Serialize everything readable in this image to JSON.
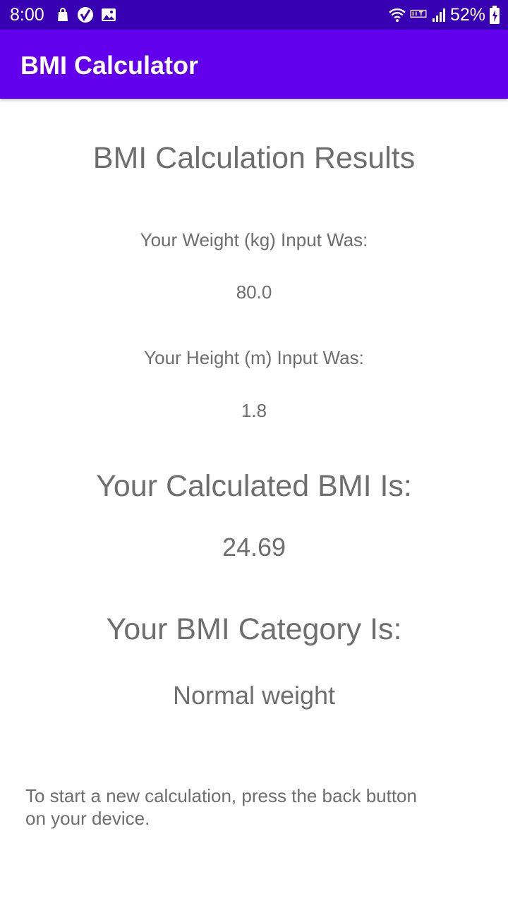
{
  "status_bar": {
    "time": "8:00",
    "battery": "52%",
    "icons": [
      "shopping-bag-icon",
      "check-circle-icon",
      "image-icon",
      "wifi-icon",
      "volte-icon",
      "signal-icon",
      "battery-icon"
    ]
  },
  "app_bar": {
    "title": "BMI Calculator",
    "color": "#6200ee",
    "status_color": "#3700b3"
  },
  "results": {
    "title": "BMI Calculation Results",
    "weight_label": "Your Weight (kg) Input Was:",
    "weight_value": "80.0",
    "height_label": "Your Height (m) Input Was:",
    "height_value": "1.8",
    "bmi_label": "Your Calculated BMI Is:",
    "bmi_value": "24.69",
    "category_label": "Your BMI Category Is:",
    "category_value": "Normal weight",
    "footer_note": "To start a new calculation, press the back button on your device."
  }
}
